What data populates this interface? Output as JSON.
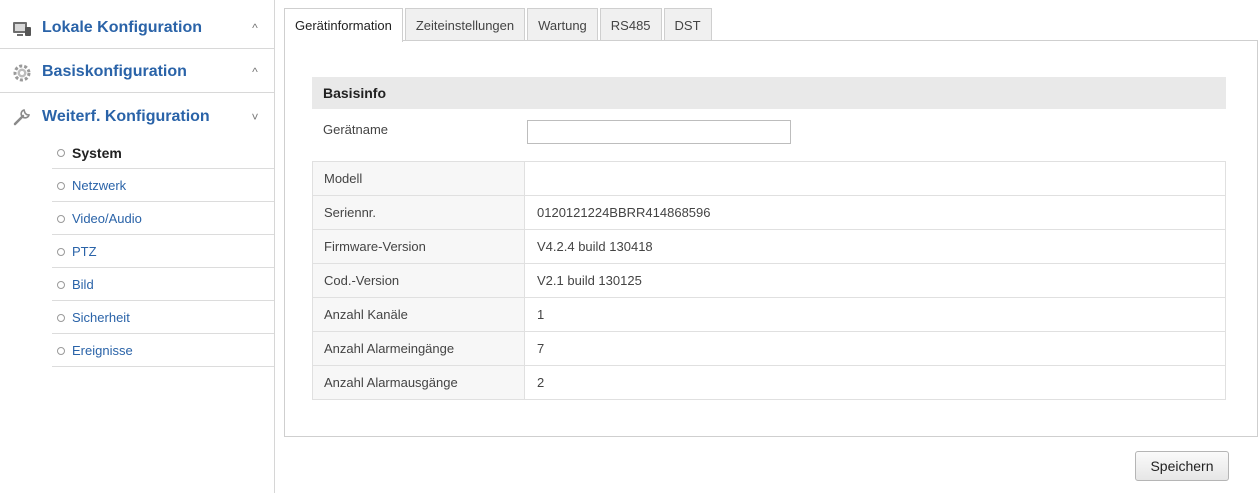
{
  "sidebar": {
    "sections": [
      {
        "label": "Lokale Konfiguration",
        "icon": "monitor-icon",
        "chevron": "^"
      },
      {
        "label": "Basiskonfiguration",
        "icon": "gear-icon",
        "chevron": "^"
      },
      {
        "label": "Weiterf. Konfiguration",
        "icon": "wrench-icon",
        "chevron": "˅"
      }
    ],
    "items": [
      {
        "label": "System",
        "active": true
      },
      {
        "label": "Netzwerk",
        "active": false
      },
      {
        "label": "Video/Audio",
        "active": false
      },
      {
        "label": "PTZ",
        "active": false
      },
      {
        "label": "Bild",
        "active": false
      },
      {
        "label": "Sicherheit",
        "active": false
      },
      {
        "label": "Ereignisse",
        "active": false
      }
    ]
  },
  "tabs": [
    {
      "label": "Gerätinformation",
      "active": true
    },
    {
      "label": "Zeiteinstellungen",
      "active": false
    },
    {
      "label": "Wartung",
      "active": false
    },
    {
      "label": "RS485",
      "active": false
    },
    {
      "label": "DST",
      "active": false
    }
  ],
  "basisinfo": {
    "header": "Basisinfo",
    "name_label": "Gerätname",
    "name_value": "",
    "rows": [
      {
        "key": "Modell",
        "value": ""
      },
      {
        "key": "Seriennr.",
        "value": "0120121224BBRR414868596"
      },
      {
        "key": "Firmware-Version",
        "value": "V4.2.4 build 130418"
      },
      {
        "key": "Cod.-Version",
        "value": "V2.1 build 130125"
      },
      {
        "key": "Anzahl Kanäle",
        "value": "1"
      },
      {
        "key": "Anzahl Alarmeingänge",
        "value": "7"
      },
      {
        "key": "Anzahl Alarmausgänge",
        "value": "2"
      }
    ]
  },
  "save_label": "Speichern",
  "colors": {
    "accent": "#2a63a8",
    "header_bg": "#e9e9e9",
    "border": "#cfcfcf"
  }
}
